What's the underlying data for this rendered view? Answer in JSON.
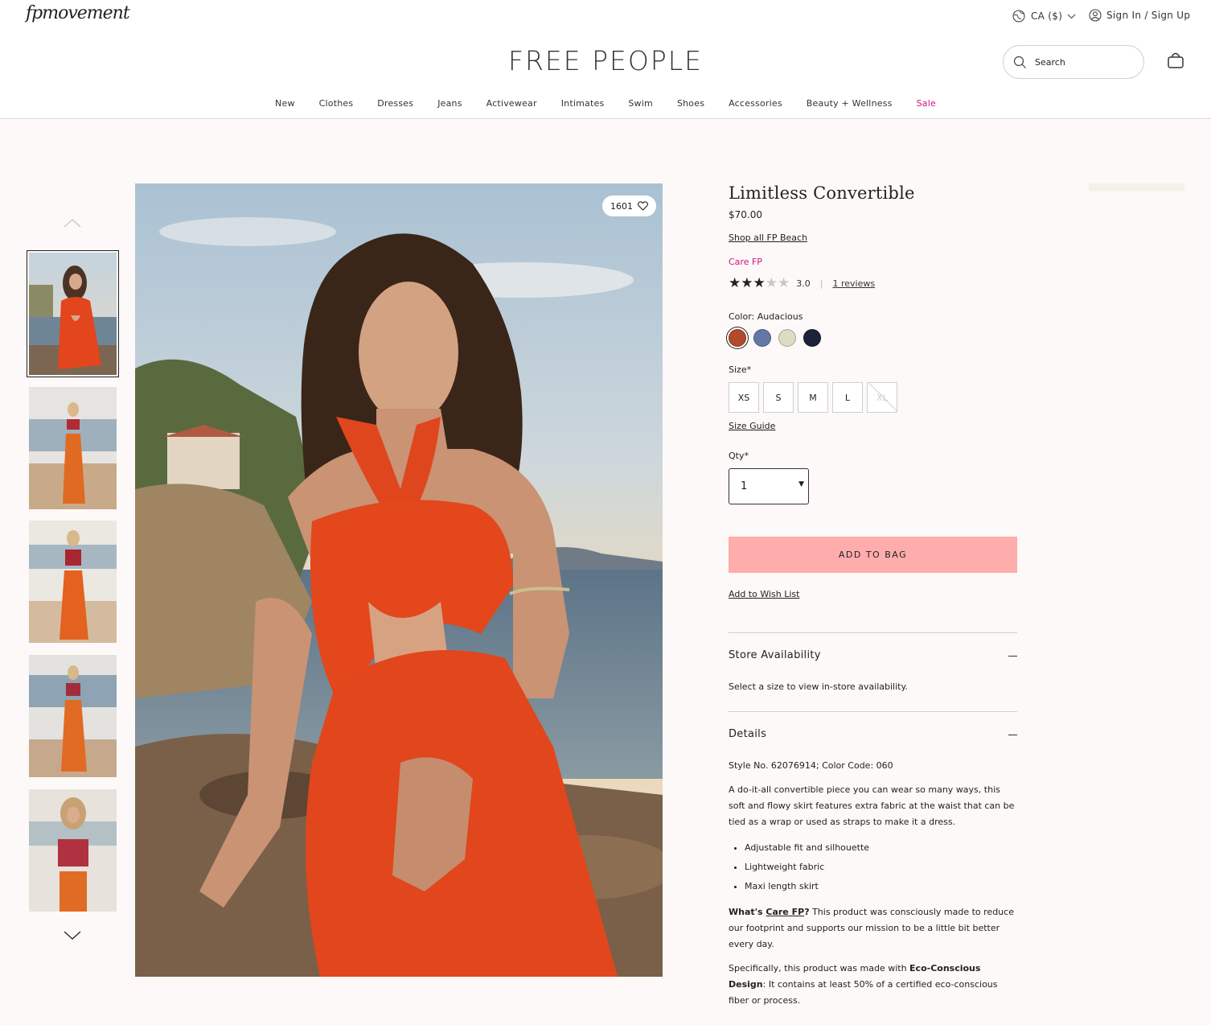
{
  "header": {
    "sublogo": "fpmovement",
    "region": "CA ($)",
    "signin": "Sign In / Sign Up",
    "brand": "FREE PEOPLE",
    "search_placeholder": "Search"
  },
  "nav": [
    "New",
    "Clothes",
    "Dresses",
    "Jeans",
    "Activewear",
    "Intimates",
    "Swim",
    "Shoes",
    "Accessories",
    "Beauty + Wellness",
    "Sale"
  ],
  "gallery": {
    "like_count": "1601",
    "thumbnail_count": 5,
    "active_thumbnail": 1
  },
  "product": {
    "title": "Limitless Convertible",
    "price": "$70.00",
    "shop_link": "Shop all FP Beach",
    "care_tag": "Care FP",
    "rating": "3.0",
    "rating_value": 3,
    "rating_max": 5,
    "reviews": "1 reviews",
    "color_label": "Color: Audacious",
    "colors": [
      {
        "name": "Audacious",
        "hex": "#b24a2c",
        "selected": true
      },
      {
        "name": "Blue",
        "hex": "#6478a6",
        "selected": false
      },
      {
        "name": "Sage",
        "hex": "#dcdcc4",
        "selected": false
      },
      {
        "name": "Navy",
        "hex": "#1c2238",
        "selected": false
      }
    ],
    "size_label": "Size*",
    "sizes": [
      {
        "label": "XS",
        "available": true
      },
      {
        "label": "S",
        "available": true
      },
      {
        "label": "M",
        "available": true
      },
      {
        "label": "L",
        "available": true
      },
      {
        "label": "XL",
        "available": false
      }
    ],
    "size_guide": "Size Guide",
    "qty_label": "Qty*",
    "qty_value": "1",
    "add_to_bag": "ADD TO BAG",
    "wish_list": "Add to Wish List"
  },
  "store_availability": {
    "title": "Store Availability",
    "text": "Select a size to view in-store availability."
  },
  "details": {
    "title": "Details",
    "style_no": "Style No. 62076914; Color Code: 060",
    "description": "A do-it-all convertible piece you can wear so many ways, this soft and flowy skirt features extra fabric at the waist that can be tied as a wrap or used as straps to make it a dress.",
    "bullets": [
      "Adjustable fit and silhouette",
      "Lightweight fabric",
      "Maxi length skirt"
    ],
    "care_q": "What's ",
    "care_link": "Care FP",
    "care_q_mark": "?",
    "care_text": " This product was consciously made to reduce our footprint and supports our mission to be a little bit better every day.",
    "eco_prefix": "Specifically, this product was made with ",
    "eco_bold": "Eco-Conscious Design",
    "eco_suffix": ": It contains at least 50% of a certified eco-conscious fiber or process."
  },
  "colors": {
    "accent_pink": "#ffacad",
    "sale_magenta": "#d2127e",
    "page_bg": "#fdf9f8"
  }
}
